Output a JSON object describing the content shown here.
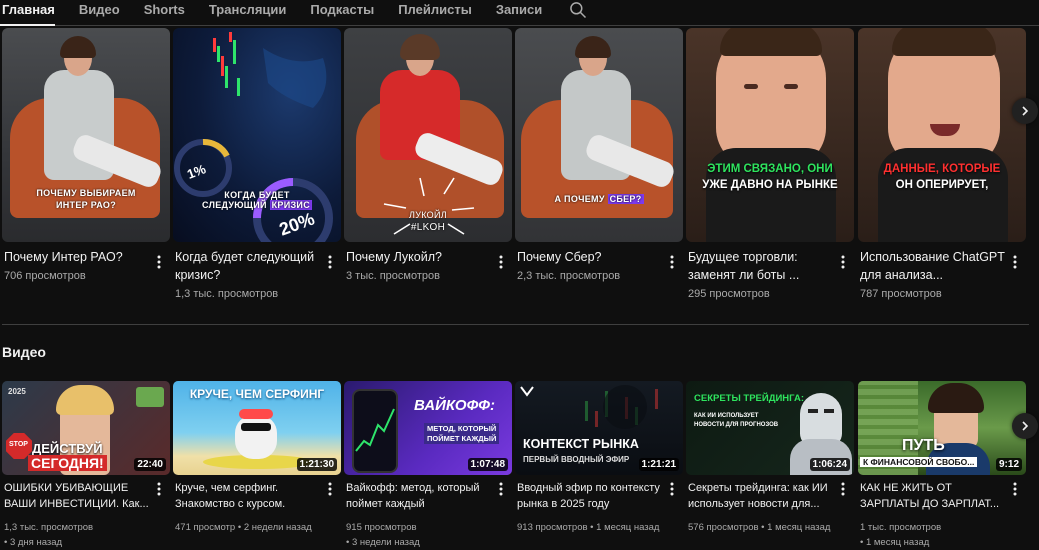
{
  "tabs": [
    "Главная",
    "Видео",
    "Shorts",
    "Трансляции",
    "Подкасты",
    "Плейлисты",
    "Записи"
  ],
  "shorts": [
    {
      "title": "Почему Интер РАО?",
      "views": "706 просмотров",
      "overlay_a": "ПОЧЕМУ ВЫБИРАЕМ",
      "overlay_b": "ИНТЕР РАО?"
    },
    {
      "title": "Когда будет следующий кризис?",
      "views": "1,3 тыс. просмотров",
      "overlay_a": "КОГДА БУДЕТ",
      "overlay_b": "СЛЕДУЮЩИЙ",
      "overlay_hl": "КРИЗИС",
      "pct_a": "1%",
      "pct_b": "20%"
    },
    {
      "title": "Почему Лукойл?",
      "views": "3 тыс. просмотров",
      "overlay_a": "ЛУКОЙЛ",
      "overlay_b": "#LKOH"
    },
    {
      "title": "Почему Сбер?",
      "views": "2,3 тыс. просмотров",
      "overlay_a": "А ПОЧЕМУ",
      "overlay_hl": "СБЕР?"
    },
    {
      "title": "Будущее торговли: заменят ли боты ...",
      "views": "295 просмотров",
      "overlay_green": "ЭТИМ СВЯЗАНО, ОНИ",
      "overlay_white": "УЖЕ ДАВНО НА РЫНКЕ"
    },
    {
      "title": "Использование ChatGPT для анализа...",
      "views": "787 просмотров",
      "overlay_red": "ДАННЫЕ, КОТОРЫЕ",
      "overlay_white": "ОН ОПЕРИРУЕТ,"
    }
  ],
  "videos_section_title": "Видео",
  "videos": [
    {
      "title": "ОШИБКИ УБИВАЮЩИЕ ВАШИ ИНВЕСТИЦИИ. Как...",
      "views": "1,3 тыс. просмотров",
      "age": "3 дня назад",
      "duration": "22:40",
      "thumb_a": "ДЕЙСТВУЙ",
      "thumb_b": "СЕГОДНЯ!",
      "thumb_c": "STOP",
      "thumb_d": "2025"
    },
    {
      "title": "Круче, чем серфинг. Знакомство с курсом.",
      "views": "471 просмотр",
      "age": "2 недели назад",
      "duration": "1:21:30",
      "thumb_a": "КРУЧЕ, ЧЕМ СЕРФИНГ"
    },
    {
      "title": "Вайкофф: метод, который поймет каждый",
      "views": "915 просмотров",
      "age": "3 недели назад",
      "duration": "1:07:48",
      "thumb_a": "ВАЙКОФФ:",
      "thumb_b": "МЕТОД, КОТОРЫЙ",
      "thumb_c": "ПОЙМЕТ КАЖДЫЙ"
    },
    {
      "title": "Вводный эфир по контексту рынка в 2025 году",
      "views": "913 просмотров",
      "age": "1 месяц назад",
      "duration": "1:21:21",
      "thumb_a": "КОНТЕКСТ РЫНКА",
      "thumb_b": "ПЕРВЫЙ ВВОДНЫЙ ЭФИР"
    },
    {
      "title": "Секреты трейдинга: как ИИ использует новости для...",
      "views": "576 просмотров",
      "age": "1 месяц назад",
      "duration": "1:06:24",
      "thumb_a": "СЕКРЕТЫ ТРЕЙДИНГА:",
      "thumb_b": "КАК ИИ ИСПОЛЬЗУЕТ",
      "thumb_c": "НОВОСТИ ДЛЯ ПРОГНОЗОВ"
    },
    {
      "title": "КАК НЕ ЖИТЬ ОТ ЗАРПЛАТЫ ДО ЗАРПЛАТ...",
      "views": "1 тыс. просмотров",
      "age": "1 месяц назад",
      "duration": "9:12",
      "thumb_a": "ПУТЬ",
      "thumb_b": "К ФИНАНСОВОЙ СВОБО..."
    }
  ],
  "meta_separator": "•",
  "colors": {
    "background": "#0f0f0f",
    "text": "#f1f1f1",
    "muted": "#aaaaaa",
    "divider": "#3f3f3f"
  }
}
